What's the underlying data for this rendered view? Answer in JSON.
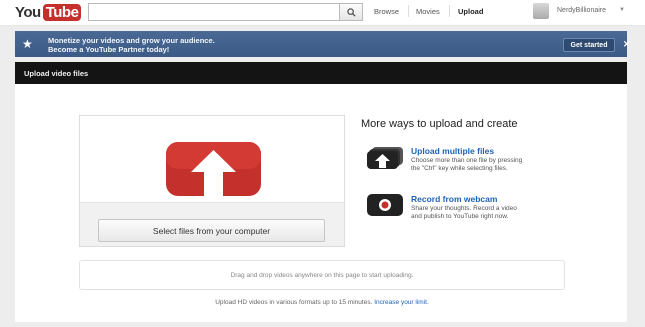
{
  "header": {
    "logo_you": "You",
    "logo_tube": "Tube",
    "search_value": "",
    "nav": [
      "Browse",
      "Movies",
      "Upload"
    ],
    "username": "NerdyBillionaire"
  },
  "banner": {
    "line1": "Monetize your videos and grow your audience.",
    "line2": "Become a YouTube Partner today!",
    "cta": "Get started",
    "close": "✕"
  },
  "page": {
    "title": "Upload video files"
  },
  "upload": {
    "select_button": "Select files from your computer",
    "more_title": "More ways to upload and create",
    "options": [
      {
        "title": "Upload multiple files",
        "desc_line1": "Choose more than one file by pressing",
        "desc_line2": "the \"Ctrl\" key while selecting files."
      },
      {
        "title": "Record from webcam",
        "desc_line1": "Share your thoughts. Record a video",
        "desc_line2": "and publish to YouTube right now."
      }
    ],
    "drop_text": "Drag and drop videos anywhere on this page to start uploading.",
    "hd_text": "Upload HD videos in various formats up to 15 minutes.",
    "hd_link": "Increase your limit."
  },
  "colors": {
    "youtube_red": "#c4302b",
    "banner_blue": "#3b5b86",
    "link_blue": "#1c62b9"
  }
}
